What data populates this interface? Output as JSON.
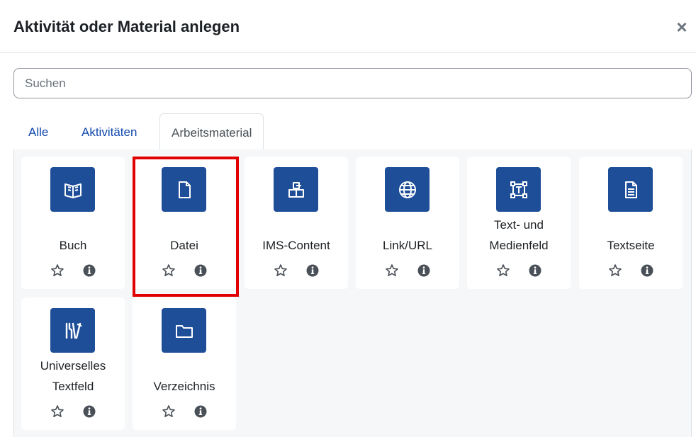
{
  "dialog": {
    "title": "Aktivität oder Material anlegen",
    "close_symbol": "×"
  },
  "search": {
    "placeholder": "Suchen",
    "value": ""
  },
  "tabs": [
    {
      "label": "Alle",
      "active": false
    },
    {
      "label": "Aktivitäten",
      "active": false
    },
    {
      "label": "Arbeitsmaterial",
      "active": true
    }
  ],
  "items": [
    {
      "label": "Buch",
      "icon": "book-icon"
    },
    {
      "label": "Datei",
      "icon": "file-icon"
    },
    {
      "label": "IMS-Content",
      "icon": "package-icon"
    },
    {
      "label": "Link/URL",
      "icon": "globe-icon"
    },
    {
      "label": "Text- und Medienfeld",
      "icon": "text-media-icon"
    },
    {
      "label": "Textseite",
      "icon": "page-icon"
    },
    {
      "label": "Universelles Textfeld",
      "icon": "tools-icon"
    },
    {
      "label": "Verzeichnis",
      "icon": "folder-icon"
    }
  ],
  "highlighted_item": "Datei",
  "colors": {
    "icon_background": "#1f4e99",
    "tab_link": "#0f47ad",
    "highlight_border": "#e00000",
    "grid_background": "#f5f7f9"
  }
}
